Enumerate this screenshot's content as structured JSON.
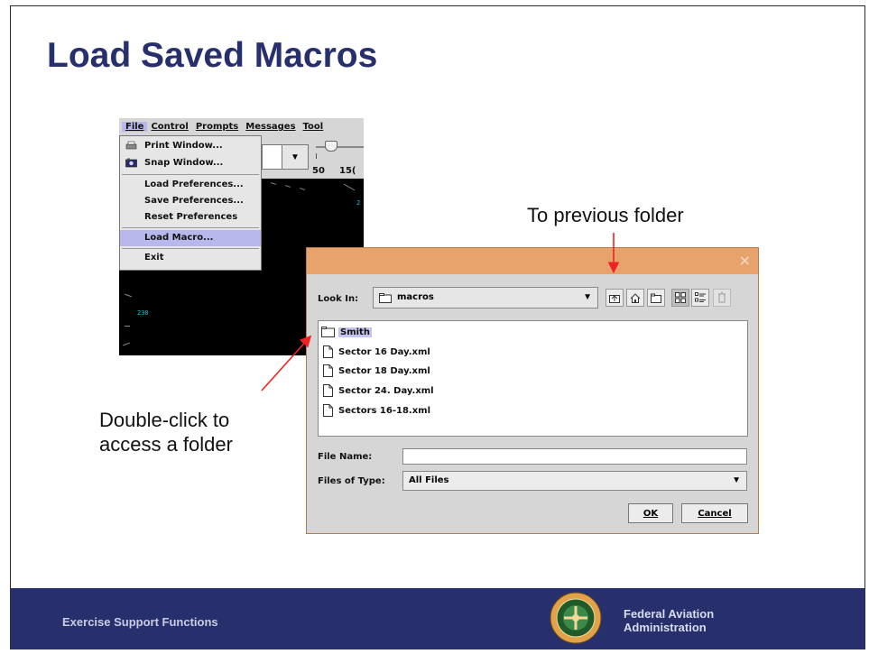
{
  "slide": {
    "title": "Load Saved Macros",
    "callout_previous": "To previous folder",
    "callout_double_line1": "Double-click to",
    "callout_double_line2": "access a folder",
    "footer_left": "Exercise Support Functions",
    "agency_line1": "Federal Aviation",
    "agency_line2": "Administration",
    "colors": {
      "title": "#27306c",
      "footer": "#27306c",
      "dialog_title": "#e8a26c",
      "arrow": "#ee2222"
    }
  },
  "app_window": {
    "menubar": [
      "File",
      "Control",
      "Prompts",
      "Messages",
      "Tool"
    ],
    "slider_labels": [
      "50",
      "15("
    ],
    "radar_labels": [
      "230",
      "2"
    ],
    "file_menu": {
      "items": [
        {
          "label": "Print Window...",
          "icon": "printer-icon"
        },
        {
          "label": "Snap Window...",
          "icon": "camera-icon"
        },
        {
          "label": "Load Preferences..."
        },
        {
          "label": "Save Preferences..."
        },
        {
          "label": "Reset Preferences"
        },
        {
          "label": "Load Macro...",
          "selected": true
        },
        {
          "label": "Exit"
        }
      ]
    }
  },
  "dialog": {
    "look_in_label": "Look In:",
    "look_in_value": "macros",
    "toolbar_icons": [
      "up-one-level-icon",
      "home-icon",
      "new-folder-icon",
      "list-view-icon",
      "details-view-icon",
      "delete-icon"
    ],
    "files": [
      {
        "name": "Smith",
        "type": "folder",
        "selected": true
      },
      {
        "name": "Sector 16 Day.xml",
        "type": "file"
      },
      {
        "name": "Sector 18 Day.xml",
        "type": "file"
      },
      {
        "name": "Sector 24. Day.xml",
        "type": "file"
      },
      {
        "name": "Sectors 16-18.xml",
        "type": "file"
      }
    ],
    "file_name_label": "File Name:",
    "file_name_value": "",
    "files_of_type_label": "Files of Type:",
    "files_of_type_value": "All Files",
    "ok_label": "OK",
    "cancel_label": "Cancel",
    "close_glyph": "×"
  }
}
